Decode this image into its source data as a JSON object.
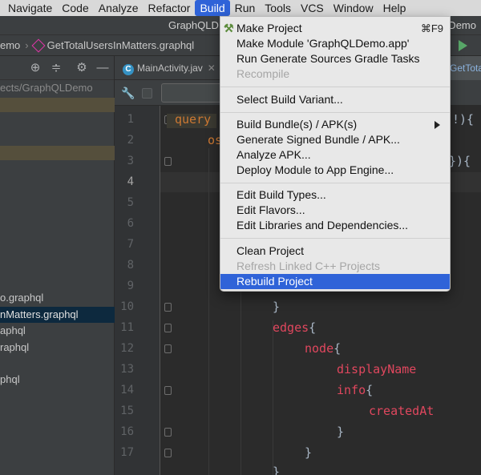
{
  "menubar": {
    "items": [
      "Navigate",
      "Code",
      "Analyze",
      "Refactor",
      "Build",
      "Run",
      "Tools",
      "VCS",
      "Window",
      "Help"
    ],
    "active": "Build"
  },
  "window": {
    "title_left": "GraphQLD",
    "title_right": "LDemo"
  },
  "navbar": {
    "crumb_project": "emo",
    "crumb_file": "GetTotalUsersInMatters.graphql"
  },
  "project_panel": {
    "path": "ects/GraphQLDemo",
    "items": [
      {
        "label": "o.graphql"
      },
      {
        "label": "nMatters.graphql",
        "selected": true
      },
      {
        "label": "aphql"
      },
      {
        "label": "raphql"
      },
      {
        "label": "phql"
      }
    ]
  },
  "tabs": {
    "main_tab": "MainActivity.jav",
    "right_tab": "GetTota"
  },
  "editor": {
    "line_numbers": [
      "1",
      "2",
      "3",
      "4",
      "5",
      "6",
      "7",
      "8",
      "9",
      "10",
      "11",
      "12",
      "13",
      "14",
      "15",
      "16",
      "17"
    ],
    "current_line": "4",
    "line1_kw": "query",
    "line1_end": "!){",
    "line2_frag": "os",
    "line3_end": "}){",
    "line10": "}",
    "line11_field": "edges",
    "line11_brace": "{",
    "line12_field": "node",
    "line12_brace": "{",
    "line13_field": "displayName",
    "line14_field": "info",
    "line14_brace": "{",
    "line15_field": "createdAt",
    "line16": "}",
    "line17": "}",
    "line18": "}"
  },
  "build_menu": {
    "make_project": "Make Project",
    "make_project_shortcut": "⌘F9",
    "make_module": "Make Module 'GraphQLDemo.app'",
    "run_generate": "Run Generate Sources Gradle Tasks",
    "recompile": "Recompile",
    "select_variant": "Select Build Variant...",
    "build_bundle": "Build Bundle(s) / APK(s)",
    "generate_signed": "Generate Signed Bundle / APK...",
    "analyze_apk": "Analyze APK...",
    "deploy_module": "Deploy Module to App Engine...",
    "edit_build_types": "Edit Build Types...",
    "edit_flavors": "Edit Flavors...",
    "edit_libraries": "Edit Libraries and Dependencies...",
    "clean_project": "Clean Project",
    "refresh_linked": "Refresh Linked C++ Projects",
    "rebuild_project": "Rebuild Project"
  },
  "colors": {
    "menubar_active": "#2f63d8",
    "graphql_field": "#e0475e",
    "keyword": "#cc7832",
    "selected_tree_row": "#0d293e"
  }
}
